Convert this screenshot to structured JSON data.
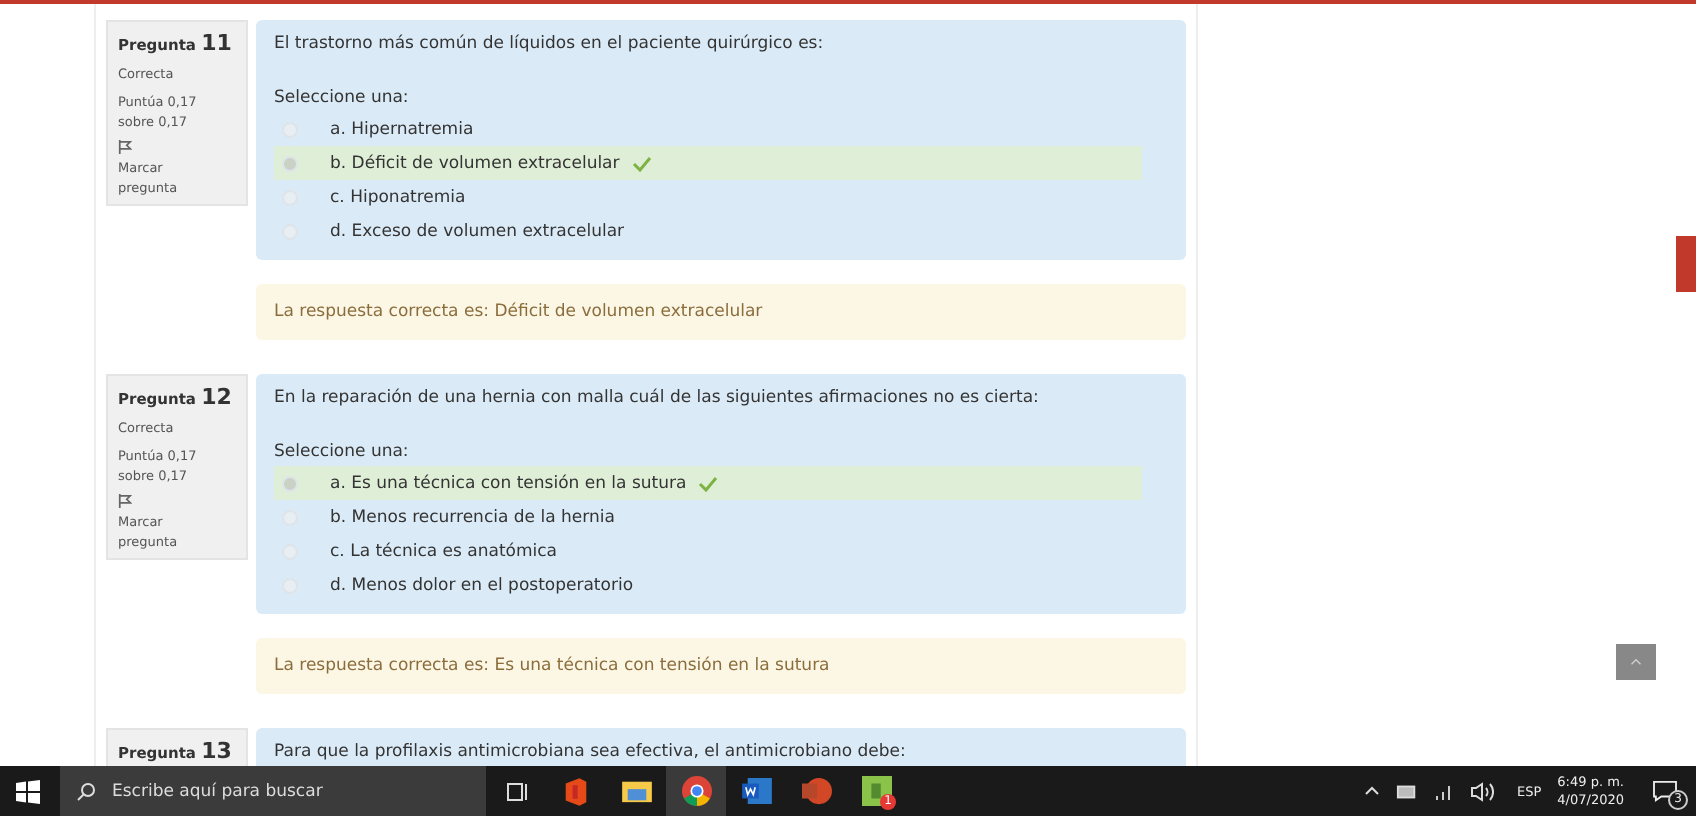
{
  "questions": [
    {
      "label": "Pregunta",
      "number": "11",
      "state": "Correcta",
      "points": "Puntúa 0,17 sobre 0,17",
      "flag": "Marcar pregunta",
      "text": "El trastorno más común de líquidos en el paciente quirúrgico es:",
      "prompt": "Seleccione una:",
      "options": [
        {
          "label": "a. Hipernatremia",
          "selected": false
        },
        {
          "label": "b. Déficit de volumen extracelular",
          "selected": true
        },
        {
          "label": "c. Hiponatremia",
          "selected": false
        },
        {
          "label": "d. Exceso de volumen extracelular",
          "selected": false
        }
      ],
      "feedback": "La respuesta correcta es: Déficit de volumen extracelular"
    },
    {
      "label": "Pregunta",
      "number": "12",
      "state": "Correcta",
      "points": "Puntúa 0,17 sobre 0,17",
      "flag": "Marcar pregunta",
      "text": "En la reparación de una hernia con malla cuál de las siguientes afirmaciones no es cierta:",
      "prompt": "Seleccione una:",
      "options": [
        {
          "label": "a. Es una técnica con tensión en la sutura",
          "selected": true
        },
        {
          "label": "b. Menos recurrencia de la hernia",
          "selected": false
        },
        {
          "label": "c. La técnica es anatómica",
          "selected": false
        },
        {
          "label": "d. Menos dolor en el postoperatorio",
          "selected": false
        }
      ],
      "feedback": "La respuesta correcta es: Es una técnica con tensión en la sutura"
    },
    {
      "label": "Pregunta",
      "number": "13",
      "text": "Para que la profilaxis antimicrobiana sea efectiva, el antimicrobiano debe:"
    }
  ],
  "taskbar": {
    "search": {
      "placeholder": "Escribe aquí para buscar"
    },
    "badge": "1",
    "language": "ESP",
    "time": "6:49 p. m.",
    "date": "4/07/2020",
    "notifications": "3"
  }
}
